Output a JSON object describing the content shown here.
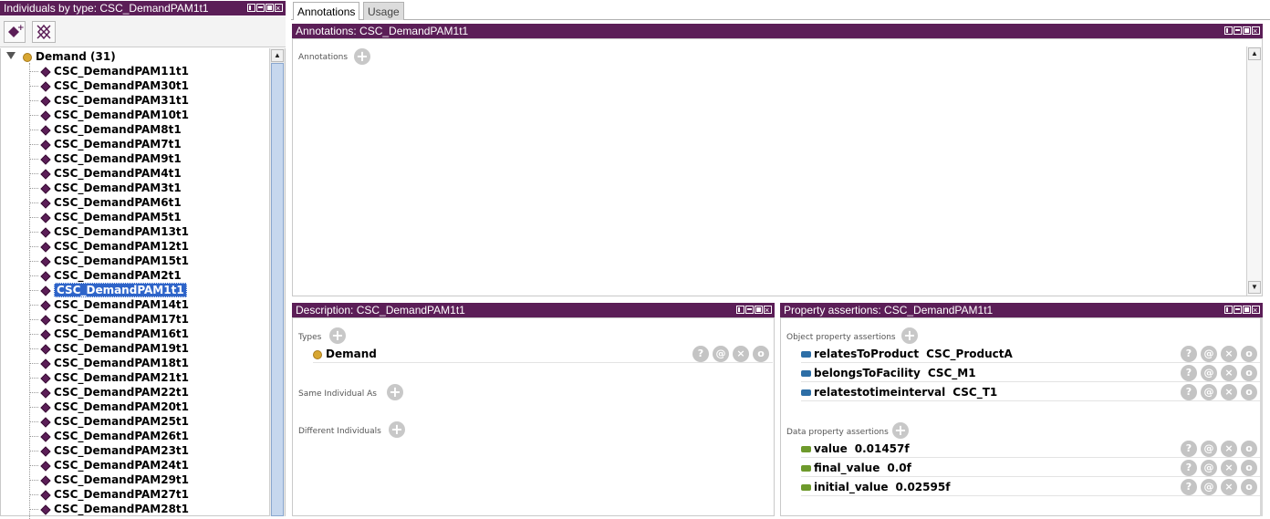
{
  "left_panel": {
    "title": "Individuals by type: CSC_DemandPAM1t1",
    "toolbar": {
      "add_icon": "add-individual-icon",
      "delete_icon": "delete-individual-icon"
    },
    "root": {
      "label": "Demand (31)"
    },
    "items": [
      "CSC_DemandPAM11t1",
      "CSC_DemandPAM30t1",
      "CSC_DemandPAM31t1",
      "CSC_DemandPAM10t1",
      "CSC_DemandPAM8t1",
      "CSC_DemandPAM7t1",
      "CSC_DemandPAM9t1",
      "CSC_DemandPAM4t1",
      "CSC_DemandPAM3t1",
      "CSC_DemandPAM6t1",
      "CSC_DemandPAM5t1",
      "CSC_DemandPAM13t1",
      "CSC_DemandPAM12t1",
      "CSC_DemandPAM15t1",
      "CSC_DemandPAM2t1",
      "CSC_DemandPAM1t1",
      "CSC_DemandPAM14t1",
      "CSC_DemandPAM17t1",
      "CSC_DemandPAM16t1",
      "CSC_DemandPAM19t1",
      "CSC_DemandPAM18t1",
      "CSC_DemandPAM21t1",
      "CSC_DemandPAM22t1",
      "CSC_DemandPAM20t1",
      "CSC_DemandPAM25t1",
      "CSC_DemandPAM26t1",
      "CSC_DemandPAM23t1",
      "CSC_DemandPAM24t1",
      "CSC_DemandPAM29t1",
      "CSC_DemandPAM27t1",
      "CSC_DemandPAM28t1"
    ],
    "selected": "CSC_DemandPAM1t1"
  },
  "tabs": [
    {
      "label": "Annotations",
      "active": true
    },
    {
      "label": "Usage",
      "active": false
    }
  ],
  "annotations_panel": {
    "title": "Annotations: CSC_DemandPAM1t1",
    "section_label": "Annotations"
  },
  "description_panel": {
    "title": "Description: CSC_DemandPAM1t1",
    "types_label": "Types",
    "types": [
      {
        "label": "Demand"
      }
    ],
    "same_label": "Same Individual As",
    "different_label": "Different Individuals"
  },
  "property_panel": {
    "title": "Property assertions: CSC_DemandPAM1t1",
    "object_label": "Object property assertions",
    "object_assertions": [
      {
        "property": "relatesToProduct",
        "value": "CSC_ProductA"
      },
      {
        "property": "belongsToFacility",
        "value": "CSC_M1"
      },
      {
        "property": "relatestotimeinterval",
        "value": "CSC_T1"
      }
    ],
    "data_label": "Data property assertions",
    "data_assertions": [
      {
        "property": "value",
        "value": "0.01457f"
      },
      {
        "property": "final_value",
        "value": "0.0f"
      },
      {
        "property": "initial_value",
        "value": "0.02595f"
      }
    ]
  },
  "row_buttons": {
    "explain": "?",
    "annotate": "@",
    "delete": "×",
    "edit": "o"
  },
  "colors": {
    "title_bar": "#5b1e57",
    "selection": "#2e64c9",
    "individual": "#5b1e57",
    "class_dot": "#d7a632",
    "object_prop": "#2d6ea6",
    "data_prop": "#6e9a2c"
  }
}
